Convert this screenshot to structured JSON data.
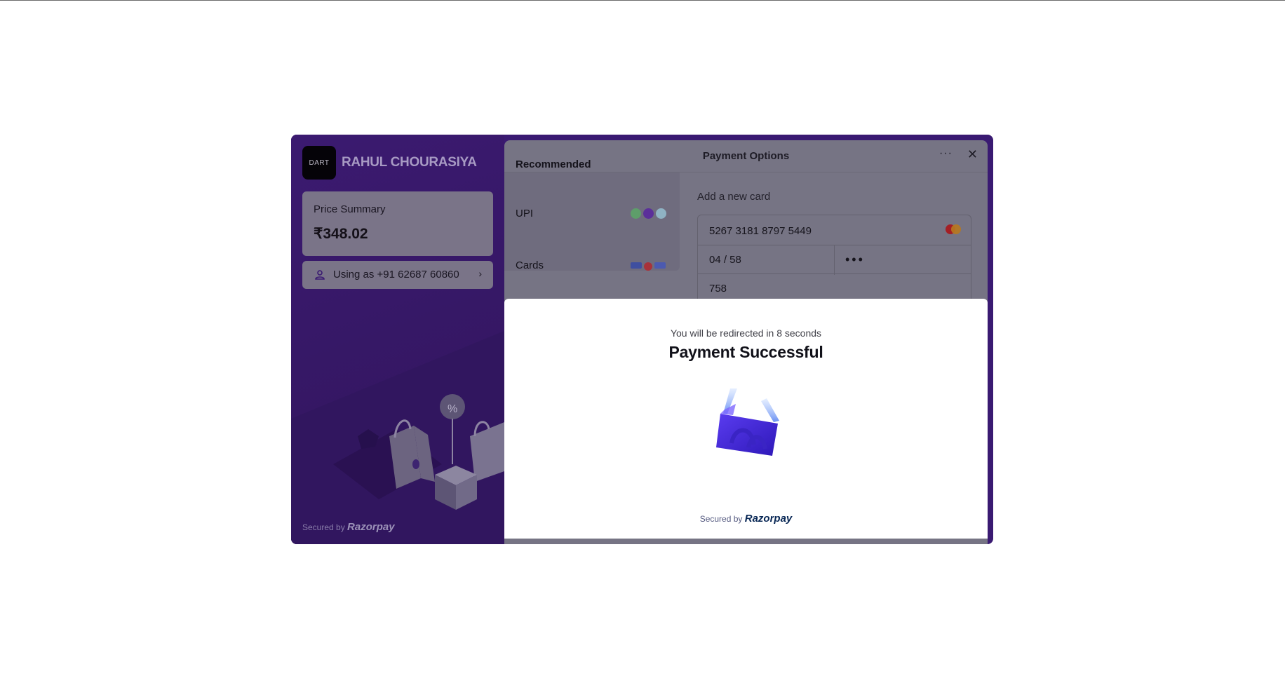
{
  "merchant": {
    "logo_text": "DART",
    "name": "RAHUL CHOURASIYA"
  },
  "price_summary": {
    "label": "Price Summary",
    "amount": "₹348.02"
  },
  "contact": {
    "text": "Using as +91 62687 60860",
    "chevron": "›"
  },
  "left_footer": {
    "secured_by": "Secured by",
    "brand": "Razorpay"
  },
  "header": {
    "title": "Payment Options",
    "more_icon": "more-dots-icon",
    "close_icon": "close-icon",
    "more_glyph": "···",
    "close_glyph": "✕"
  },
  "methods": [
    {
      "label": "Recommended"
    },
    {
      "label": "UPI"
    },
    {
      "label": "Cards"
    }
  ],
  "card_form": {
    "heading": "Add a new card",
    "card_number": "5267 3181 8797 5449",
    "expiry": "04 / 58",
    "cvv": "•••",
    "name": "758"
  },
  "success": {
    "redirect_text": "You will be redirected in 8 seconds",
    "title": "Payment Successful",
    "secured_by": "Secured by",
    "brand": "Razorpay"
  },
  "colors": {
    "brand_purple": "#3a1a72",
    "success_art": "#4a2bdf",
    "razorpay_navy": "#072654"
  }
}
